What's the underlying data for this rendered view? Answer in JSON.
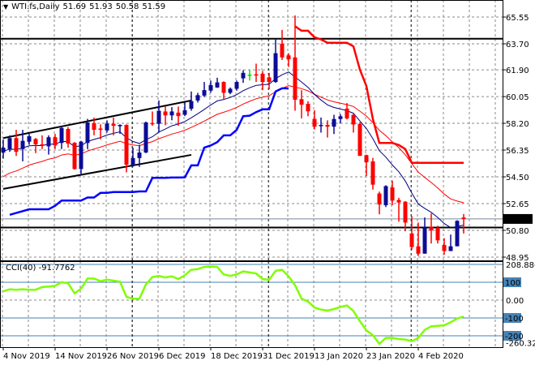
{
  "header": {
    "symbol": "WTI.fs,Daily",
    "open": "51.69",
    "high": "51.93",
    "low": "50.58",
    "close": "51.59"
  },
  "cci_header": {
    "name": "CCI(40)",
    "value": "-91.7762"
  },
  "colors": {
    "bull": "#0c0c96",
    "bear": "#ff0000",
    "doji": "#00e000",
    "ma_fast": "#000080",
    "ma_slow": "#ff0000",
    "channel_low": "#0000ff",
    "channel_high": "#ff0000",
    "cci": "#7fff00",
    "level": "#4682b4",
    "grid": "#8a8a8a"
  },
  "chart_data": [
    {
      "type": "candlestick",
      "title": "WTI.fs,Daily",
      "ylim": [
        48.95,
        65.55
      ],
      "y_ticks": [
        "65.55",
        "63.70",
        "61.90",
        "60.05",
        "58.20",
        "56.35",
        "54.50",
        "52.65",
        "50.80",
        "48.95"
      ],
      "x_tick_labels": [
        "4 Nov 2019",
        "14 Nov 2019",
        "26 Nov 2019",
        "6 Dec 2019",
        "18 Dec 2019",
        "31 Dec 2019",
        "13 Jan 2020",
        "23 Jan 2020",
        "4 Feb 2020"
      ],
      "x_tick_index": [
        0,
        8,
        16,
        24,
        32,
        40,
        48,
        56,
        64
      ],
      "current_price_label": "51.59",
      "candles_ohlc": [
        [
          56.18,
          57.09,
          55.76,
          56.52
        ],
        [
          56.42,
          57.37,
          56.23,
          57.18
        ],
        [
          57.18,
          57.75,
          55.95,
          56.23
        ],
        [
          56.42,
          57.75,
          55.57,
          56.99
        ],
        [
          56.93,
          57.47,
          56.71,
          57.31
        ],
        [
          57.12,
          57.18,
          56.14,
          56.75
        ],
        [
          56.75,
          57.37,
          56.42,
          56.65
        ],
        [
          56.61,
          57.37,
          56.04,
          57.24
        ],
        [
          57.24,
          57.47,
          56.42,
          56.67
        ],
        [
          56.84,
          58.03,
          56.42,
          57.88
        ],
        [
          57.81,
          57.94,
          56.52,
          56.8
        ],
        [
          56.86,
          56.9,
          55.0,
          55.04
        ],
        [
          55.04,
          56.99,
          54.62,
          56.93
        ],
        [
          56.84,
          58.51,
          56.42,
          58.26
        ],
        [
          58.22,
          58.6,
          57.37,
          57.75
        ],
        [
          57.84,
          58.13,
          57.09,
          57.81
        ],
        [
          57.71,
          58.41,
          57.56,
          58.18
        ],
        [
          58.17,
          58.6,
          57.37,
          58.03
        ],
        [
          58.0,
          58.13,
          57.47,
          58.09
        ],
        [
          58.09,
          58.13,
          54.81,
          55.34
        ],
        [
          55.29,
          56.52,
          55.19,
          55.8
        ],
        [
          55.8,
          56.71,
          55.19,
          56.18
        ],
        [
          56.18,
          58.32,
          56.14,
          58.26
        ],
        [
          58.22,
          59.02,
          58.03,
          58.17
        ],
        [
          58.17,
          59.78,
          57.56,
          59.07
        ],
        [
          59.02,
          59.36,
          58.07,
          58.75
        ],
        [
          58.75,
          59.32,
          58.41,
          59.02
        ],
        [
          58.94,
          59.36,
          58.03,
          58.7
        ],
        [
          58.79,
          59.64,
          58.7,
          59.11
        ],
        [
          59.21,
          60.4,
          59.07,
          59.74
        ],
        [
          59.78,
          60.31,
          59.64,
          60.15
        ],
        [
          60.12,
          61.06,
          60.02,
          60.5
        ],
        [
          60.46,
          61.16,
          60.31,
          60.84
        ],
        [
          60.68,
          61.35,
          60.65,
          61.03
        ],
        [
          61.06,
          61.1,
          59.89,
          60.31
        ],
        [
          60.31,
          60.68,
          60.21,
          60.59
        ],
        [
          60.59,
          61.16,
          60.46,
          61.06
        ],
        [
          61.31,
          61.87,
          61.0,
          61.69
        ],
        [
          61.57,
          61.87,
          61.16,
          61.57
        ],
        [
          61.59,
          62.33,
          61.06,
          61.55
        ],
        [
          61.63,
          61.82,
          60.49,
          61.06
        ],
        [
          61.38,
          61.69,
          60.55,
          61.06
        ],
        [
          61.06,
          64.03,
          61.0,
          63.05
        ],
        [
          63.71,
          64.66,
          62.58,
          62.76
        ],
        [
          62.9,
          63.05,
          62.1,
          62.63
        ],
        [
          62.76,
          65.66,
          59.07,
          59.83
        ],
        [
          59.87,
          60.49,
          58.54,
          59.49
        ],
        [
          59.55,
          59.73,
          58.69,
          59.03
        ],
        [
          58.5,
          59.11,
          57.78,
          57.97
        ],
        [
          58.01,
          58.6,
          57.56,
          58.09
        ],
        [
          58.09,
          58.41,
          57.22,
          57.97
        ],
        [
          57.97,
          58.79,
          57.46,
          58.5
        ],
        [
          58.5,
          58.84,
          58.22,
          58.69
        ],
        [
          59.22,
          59.6,
          58.47,
          58.54
        ],
        [
          58.79,
          58.84,
          57.56,
          58.12
        ],
        [
          58.16,
          58.28,
          55.95,
          55.95
        ],
        [
          56.0,
          56.04,
          54.56,
          55.51
        ],
        [
          55.57,
          55.81,
          53.62,
          53.96
        ],
        [
          53.35,
          53.48,
          51.91,
          52.59
        ],
        [
          52.54,
          53.92,
          52.41,
          53.86
        ],
        [
          53.77,
          54.24,
          52.54,
          52.86
        ],
        [
          52.9,
          53.05,
          51.4,
          52.73
        ],
        [
          52.78,
          52.82,
          50.74,
          51.34
        ],
        [
          50.59,
          51.78,
          49.45,
          49.64
        ],
        [
          49.7,
          51.34,
          49.03,
          49.19
        ],
        [
          49.19,
          51.69,
          49.19,
          50.98
        ],
        [
          51.06,
          51.97,
          49.89,
          50.8
        ],
        [
          50.97,
          51.12,
          49.89,
          50.11
        ],
        [
          49.79,
          50.26,
          49.13,
          49.37
        ],
        [
          49.37,
          50.51,
          49.37,
          49.7
        ],
        [
          49.7,
          51.5,
          49.7,
          51.46
        ],
        [
          51.69,
          51.93,
          50.58,
          51.59
        ]
      ],
      "ma_fast": {
        "period": 10,
        "seed": 56.2
      },
      "ma_slow": {
        "period": 20,
        "seed": 54.3
      },
      "channel_low": {
        "start_index": 1,
        "values": [
          51.88,
          52.0,
          52.13,
          52.26,
          52.26,
          52.26,
          52.26,
          52.5,
          52.86,
          52.86,
          52.86,
          52.86,
          53.07,
          53.07,
          53.39,
          53.39,
          53.45,
          53.45,
          53.45,
          53.45,
          53.49,
          53.49,
          54.43,
          54.43,
          54.43,
          54.45,
          54.45,
          54.47,
          55.29,
          55.29,
          56.52,
          56.67,
          56.9,
          57.37,
          57.37,
          57.75,
          58.69,
          58.73,
          58.98,
          59.17,
          59.17,
          60.4,
          60.62,
          60.62
        ]
      },
      "channel_high": {
        "start_index": 45,
        "values": [
          64.91,
          64.6,
          64.6,
          64.15,
          64.0,
          63.77,
          63.77,
          63.77,
          63.77,
          63.52,
          61.91,
          60.78,
          58.5,
          56.84,
          56.84,
          56.84,
          56.7,
          56.42,
          55.47,
          55.47,
          55.47,
          55.47,
          55.47,
          55.47,
          55.47,
          55.47,
          55.47
        ]
      },
      "horizontal_lines": [
        64.05,
        51.0
      ],
      "trendlines": [
        {
          "from": [
            0,
            57.18
          ],
          "to": [
            29,
            59.78
          ]
        },
        {
          "from": [
            0,
            53.67
          ],
          "to": [
            29,
            56.02
          ]
        }
      ],
      "separators_index": [
        19.9,
        40.9,
        62.9
      ]
    },
    {
      "type": "line",
      "title": "CCI(40)",
      "ylim": [
        -260.322,
        208.8864
      ],
      "y_ticks": [
        "208.8864",
        "100",
        "0.00",
        "-100",
        "-200",
        "-260.322"
      ],
      "levels": [
        200,
        100,
        -100,
        -200
      ],
      "values": [
        49,
        61,
        58,
        61,
        58,
        58,
        73,
        76,
        80,
        101,
        94,
        38,
        64,
        121,
        121,
        106,
        115,
        109,
        103,
        18,
        8,
        8,
        88,
        129,
        136,
        127,
        133,
        118,
        139,
        170,
        174,
        186,
        188,
        186,
        144,
        136,
        144,
        161,
        155,
        149,
        118,
        114,
        164,
        170,
        133,
        83,
        8,
        -8,
        -42,
        -53,
        -58,
        -50,
        -38,
        -30,
        -61,
        -118,
        -170,
        -197,
        -245,
        -212,
        -212,
        -218,
        -221,
        -230,
        -212,
        -167,
        -147,
        -144,
        -141,
        -124,
        -103,
        -91.78
      ]
    }
  ]
}
